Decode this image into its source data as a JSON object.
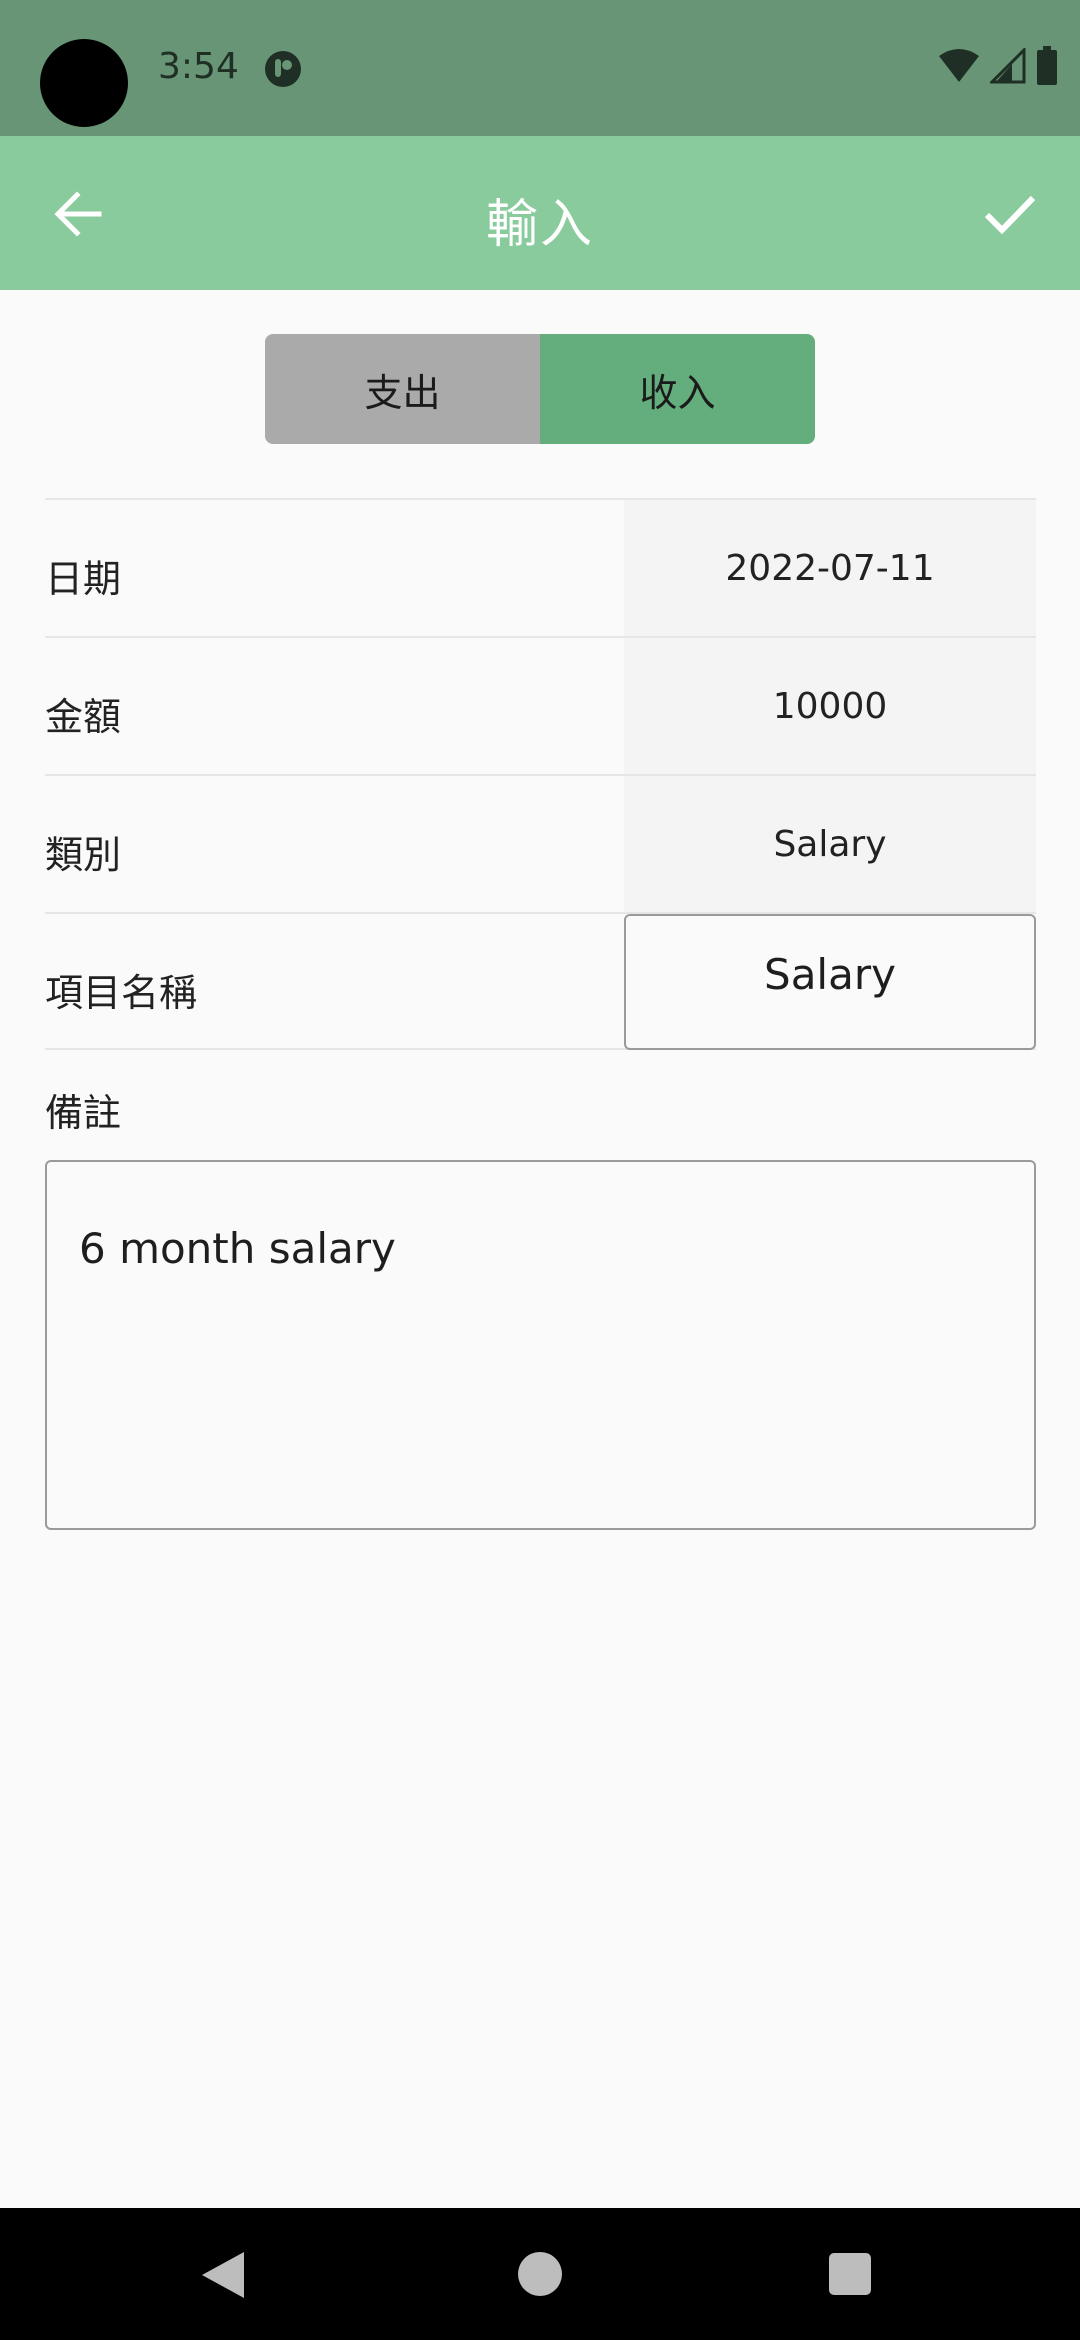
{
  "status_bar": {
    "time": "3:54",
    "icons": [
      "app-notification-icon",
      "wifi-icon",
      "signal-icon",
      "battery-icon"
    ]
  },
  "app_bar": {
    "title": "輸入",
    "back_icon": "arrow-left-icon",
    "confirm_icon": "check-icon"
  },
  "segmented": {
    "expense_label": "支出",
    "income_label": "收入",
    "selected": "收入"
  },
  "form": {
    "date_label": "日期",
    "date_value": "2022-07-11",
    "amount_label": "金額",
    "amount_value": "10000",
    "category_label": "類別",
    "category_value": "Salary",
    "item_name_label": "項目名稱",
    "item_name_value": "Salary",
    "note_label": "備註",
    "note_value": "6 month salary"
  },
  "colors": {
    "status_bar": "#679575",
    "app_bar": "#89cb9c",
    "segment_selected": "#64ad7c",
    "segment_unselected": "#aaaaaa"
  }
}
